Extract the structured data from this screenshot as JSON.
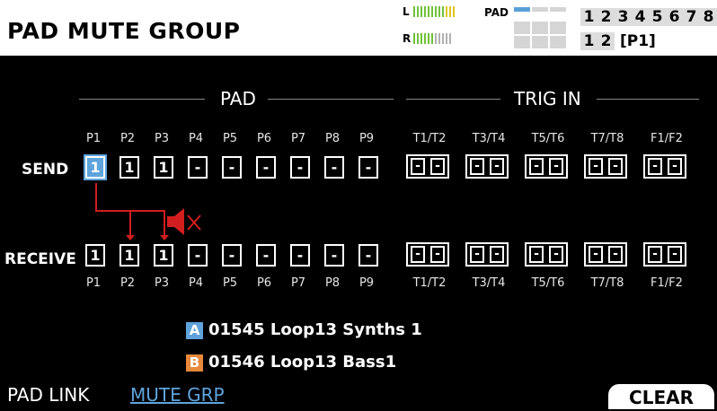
{
  "header": {
    "title": "PAD MUTE GROUP",
    "meter_l": "L",
    "meter_r": "R",
    "pad_label": "PAD",
    "bank_numbers": [
      "1",
      "2",
      "3",
      "4",
      "5",
      "6",
      "7",
      "8"
    ],
    "kit_numbers": [
      "1",
      "2"
    ],
    "current_pad": "[P1]"
  },
  "sections": {
    "pad": "PAD",
    "trig_in": "TRIG IN"
  },
  "pads": [
    "P1",
    "P2",
    "P3",
    "P4",
    "P5",
    "P6",
    "P7",
    "P8",
    "P9"
  ],
  "trigs": [
    "T1/T2",
    "T3/T4",
    "T5/T6",
    "T7/T8",
    "F1/F2"
  ],
  "send": {
    "label": "SEND",
    "pad_values": [
      "1",
      "1",
      "1",
      "-",
      "-",
      "-",
      "-",
      "-",
      "-"
    ],
    "trig_values": [
      "-",
      "-",
      "-",
      "-",
      "-",
      "-",
      "-",
      "-",
      "-",
      "-"
    ]
  },
  "receive": {
    "label": "RECEIVE",
    "pad_values": [
      "1",
      "1",
      "1",
      "-",
      "-",
      "-",
      "-",
      "-",
      "-"
    ],
    "trig_values": [
      "-",
      "-",
      "-",
      "-",
      "-",
      "-",
      "-",
      "-",
      "-",
      "-"
    ]
  },
  "kits": [
    {
      "badge": "A",
      "name": "01545 Loop13 Synths 1",
      "color": "#5fa3dc"
    },
    {
      "badge": "B",
      "name": "01546 Loop13 Bass1",
      "color": "#e8883a"
    }
  ],
  "footer": {
    "pad_link": "PAD LINK",
    "mute_grp": "MUTE GRP",
    "clear": "CLEAR"
  }
}
